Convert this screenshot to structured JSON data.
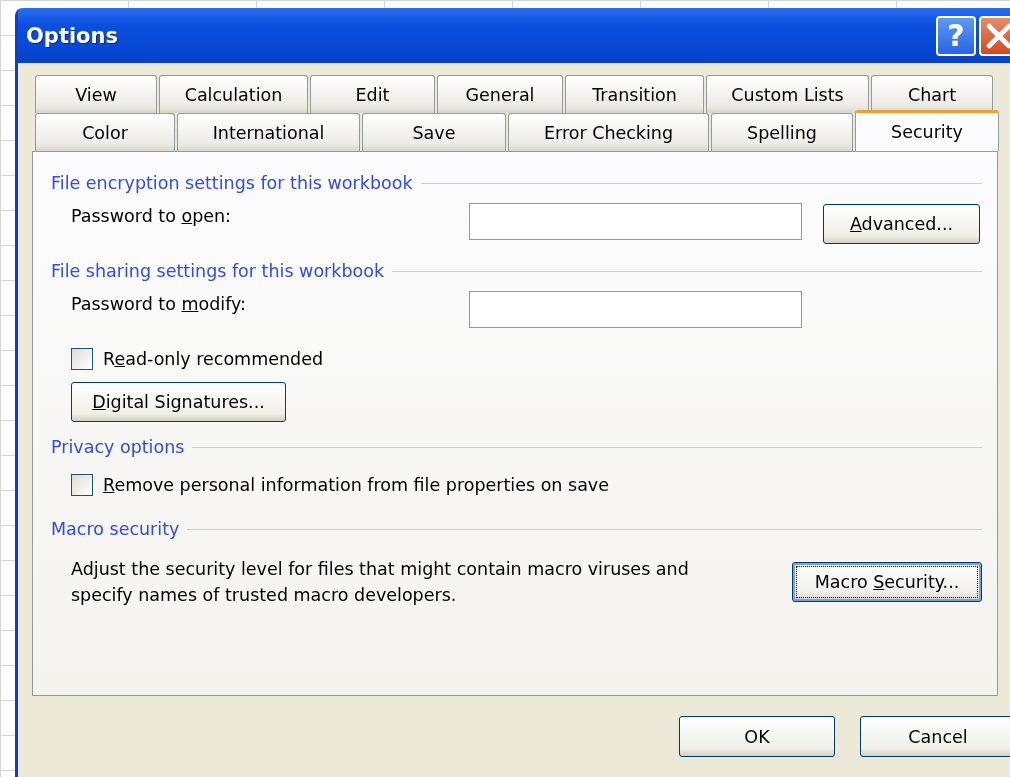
{
  "window": {
    "title": "Options",
    "help_glyph": "?"
  },
  "tab_rows": [
    [
      {
        "label": "View",
        "selected": false
      },
      {
        "label": "Calculation",
        "selected": false
      },
      {
        "label": "Edit",
        "selected": false
      },
      {
        "label": "General",
        "selected": false
      },
      {
        "label": "Transition",
        "selected": false
      },
      {
        "label": "Custom Lists",
        "selected": false
      },
      {
        "label": "Chart",
        "selected": false
      }
    ],
    [
      {
        "label": "Color",
        "selected": false
      },
      {
        "label": "International",
        "selected": false
      },
      {
        "label": "Save",
        "selected": false
      },
      {
        "label": "Error Checking",
        "selected": false
      },
      {
        "label": "Spelling",
        "selected": false
      },
      {
        "label": "Security",
        "selected": true
      }
    ]
  ],
  "sections": [
    {
      "title": "File encryption settings for this workbook",
      "rows": [
        {
          "kind": "field",
          "label": {
            "before": "Password to ",
            "key": "o",
            "after": "pen:"
          },
          "button": {
            "key": "A",
            "after": "dvanced..."
          }
        }
      ]
    },
    {
      "title": "File sharing settings for this workbook",
      "rows": [
        {
          "kind": "field",
          "label": {
            "before": "Password to ",
            "key": "m",
            "after": "odify:"
          }
        },
        {
          "kind": "checkbox",
          "checked": false,
          "label": {
            "before": "R",
            "key": "e",
            "after": "ad-only recommended"
          }
        },
        {
          "kind": "button",
          "button": {
            "key": "D",
            "after": "igital Signatures..."
          }
        }
      ]
    },
    {
      "title": "Privacy options",
      "rows": [
        {
          "kind": "checkbox",
          "checked": false,
          "label": {
            "key": "R",
            "after": "emove personal information from file properties on save"
          }
        }
      ]
    },
    {
      "title": "Macro security",
      "rows": [
        {
          "kind": "text_button",
          "text": "Adjust the security level for files that might contain macro viruses and specify names of trusted macro developers.",
          "button": {
            "before": "Macro ",
            "key": "S",
            "after": "ecurity..."
          },
          "focused": true
        }
      ]
    }
  ],
  "buttons": [
    "OK",
    "Cancel"
  ]
}
